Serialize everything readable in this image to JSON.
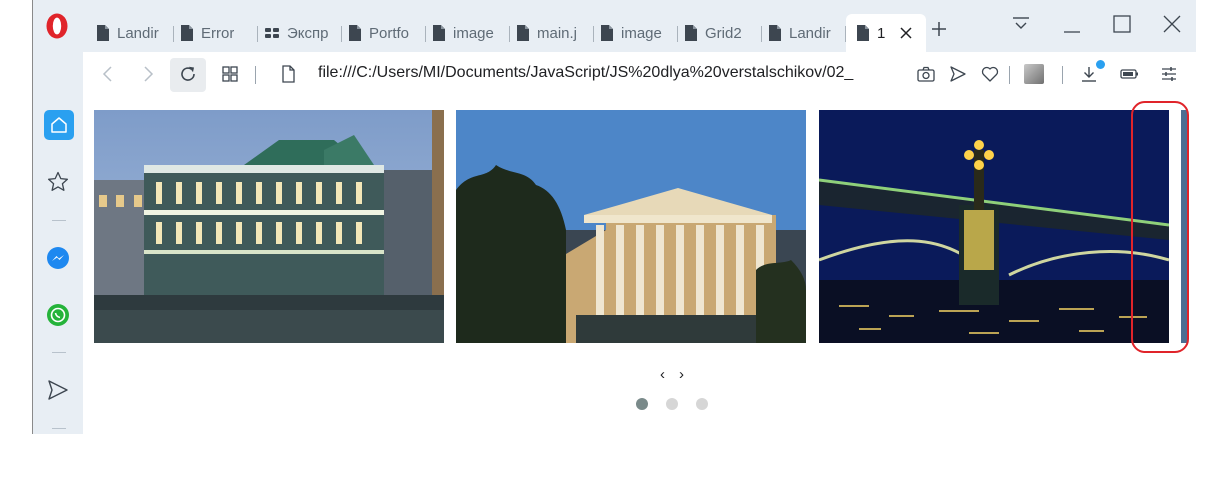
{
  "tabs": [
    {
      "label": "Landir",
      "icon": "document-icon",
      "active": false
    },
    {
      "label": "Error",
      "icon": "document-icon",
      "active": false
    },
    {
      "label": "Экспр",
      "icon": "apps-grid-icon",
      "active": false
    },
    {
      "label": "Portfo",
      "icon": "document-icon",
      "active": false
    },
    {
      "label": "image",
      "icon": "document-icon",
      "active": false
    },
    {
      "label": "main.j",
      "icon": "document-icon",
      "active": false
    },
    {
      "label": "image",
      "icon": "document-icon",
      "active": false
    },
    {
      "label": "Grid2",
      "icon": "document-icon",
      "active": false
    },
    {
      "label": "Landir",
      "icon": "document-icon",
      "active": false
    },
    {
      "label": "1",
      "icon": "document-icon",
      "active": true
    }
  ],
  "address": {
    "url": "file:///C:/Users/MI/Documents/JavaScript/JS%20dlya%20verstalschikov/02_"
  },
  "slider": {
    "prev_arrow": "‹",
    "next_arrow": "›",
    "slides": [
      {
        "subject": "illuminated palace at dusk"
      },
      {
        "subject": "classical building with columns"
      },
      {
        "subject": "bridge at night with lanterns"
      }
    ],
    "dots": 3,
    "active_dot": 0
  },
  "colors": {
    "tabbar_bg": "#e8eef4",
    "accent": "#2aa0f0",
    "opera_red": "#e0242a",
    "highlight_red": "#e0242a",
    "dot_active": "#7a8a8a",
    "dot_inactive": "#d6d6d6"
  }
}
